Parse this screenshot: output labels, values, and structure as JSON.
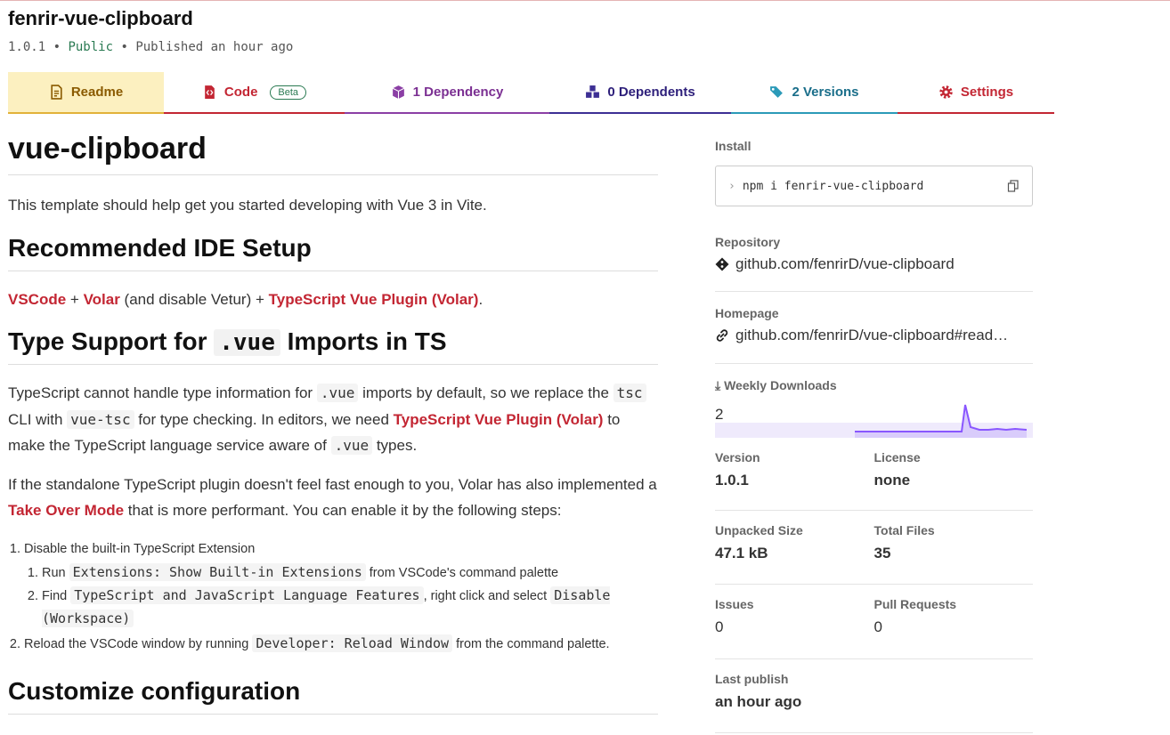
{
  "header": {
    "title": "fenrir-vue-clipboard",
    "version": "1.0.1",
    "visibility": "Public",
    "published": "Published an hour ago"
  },
  "tabs": [
    {
      "label": "Readme",
      "icon": "readme-icon"
    },
    {
      "label": "Code",
      "icon": "code-icon",
      "badge": "Beta"
    },
    {
      "label": "1 Dependency",
      "icon": "cube-icon"
    },
    {
      "label": "0 Dependents",
      "icon": "cubes-icon"
    },
    {
      "label": "2 Versions",
      "icon": "tags-icon"
    },
    {
      "label": "Settings",
      "icon": "gear-icon"
    }
  ],
  "readme": {
    "title": "vue-clipboard",
    "intro": "This template should help get you started developing with Vue 3 in Vite.",
    "ide_heading": "Recommended IDE Setup",
    "ide_links": {
      "vscode": "VSCode",
      "volar": "Volar",
      "plugin": "TypeScript Vue Plugin (Volar)"
    },
    "ide_text": {
      "plus1": " + ",
      "mid": " (and disable Vetur) + ",
      "end": "."
    },
    "ts_heading": {
      "pre": "Type Support for ",
      "code": ".vue",
      "post": " Imports in TS"
    },
    "ts_para": {
      "t1": "TypeScript cannot handle type information for ",
      "c1": ".vue",
      "t2": " imports by default, so we replace the ",
      "c2": "tsc",
      "t3": " CLI with ",
      "c3": "vue-tsc",
      "t4": " for type checking. In editors, we need ",
      "link": "TypeScript Vue Plugin (Volar)",
      "t5": " to make the TypeScript language service aware of ",
      "c4": ".vue",
      "t6": " types."
    },
    "takeover_para": {
      "t1": "If the standalone TypeScript plugin doesn't feel fast enough to you, Volar has also implemented a ",
      "link": "Take Over Mode",
      "t2": " that is more performant. You can enable it by the following steps:"
    },
    "steps": {
      "s1": "Disable the built-in TypeScript Extension",
      "s1a_pre": "Run ",
      "s1a_code": "Extensions: Show Built-in Extensions",
      "s1a_post": " from VSCode's command palette",
      "s1b_pre": "Find ",
      "s1b_code": "TypeScript and JavaScript Language Features",
      "s1b_mid": ", right click and select ",
      "s1b_code2": "Disable (Workspace)",
      "s2_pre": "Reload the VSCode window by running ",
      "s2_code": "Developer: Reload Window",
      "s2_post": " from the command palette."
    },
    "config_heading": "Customize configuration"
  },
  "sidebar": {
    "install_label": "Install",
    "install_cmd": "npm i fenrir-vue-clipboard",
    "repository_label": "Repository",
    "repository": "github.com/fenrirD/vue-clipboard",
    "homepage_label": "Homepage",
    "homepage": "github.com/fenrirD/vue-clipboard#read…",
    "weekly_label": "Weekly Downloads",
    "weekly_value": "2",
    "version_label": "Version",
    "version": "1.0.1",
    "license_label": "License",
    "license": "none",
    "unpacked_label": "Unpacked Size",
    "unpacked": "47.1 kB",
    "files_label": "Total Files",
    "files": "35",
    "issues_label": "Issues",
    "issues": "0",
    "prs_label": "Pull Requests",
    "prs": "0",
    "last_publish_label": "Last publish",
    "last_publish": "an hour ago"
  },
  "colors": {
    "accent": "#c32633",
    "chart": "#8956ff"
  }
}
